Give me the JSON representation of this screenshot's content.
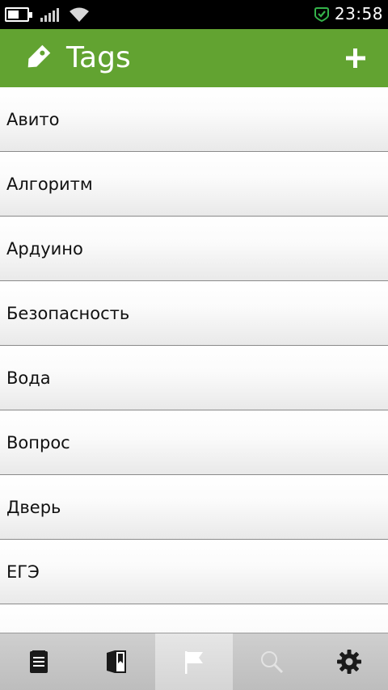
{
  "status_bar": {
    "time": "23:58",
    "battery_level": 0.6,
    "icons": [
      "battery-icon",
      "signal-icon",
      "wifi-icon",
      "sync-check-icon"
    ],
    "check_color": "#34b34a"
  },
  "header": {
    "title": "Tags",
    "icon": "tag-icon",
    "add_icon": "plus-icon",
    "background": "#62a331"
  },
  "tags": [
    {
      "label": "Авито"
    },
    {
      "label": "Алгоритм"
    },
    {
      "label": "Ардуино"
    },
    {
      "label": "Безопасность"
    },
    {
      "label": "Вода"
    },
    {
      "label": "Вопрос"
    },
    {
      "label": "Дверь"
    },
    {
      "label": "ЕГЭ"
    },
    {
      "label": ""
    }
  ],
  "toolbar": {
    "buttons": [
      {
        "name": "notes-icon",
        "active": false
      },
      {
        "name": "notebook-icon",
        "active": false
      },
      {
        "name": "flag-icon",
        "active": true
      },
      {
        "name": "search-icon",
        "active": false
      },
      {
        "name": "gear-icon",
        "active": false
      }
    ]
  }
}
